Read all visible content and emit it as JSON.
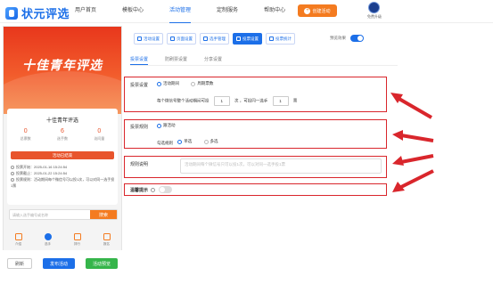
{
  "logo": {
    "text": "状元评选"
  },
  "nav": {
    "items": [
      {
        "label": "用户首页",
        "active": false
      },
      {
        "label": "模板中心",
        "active": false
      },
      {
        "label": "活动管理",
        "active": true
      },
      {
        "label": "定制服务",
        "active": false
      },
      {
        "label": "帮助中心",
        "active": false
      }
    ],
    "create_label": "创建活动",
    "user_label": "免费升级"
  },
  "preview": {
    "banner_title": "十佳青年评选",
    "card_title": "十佳青年评选",
    "stats": [
      {
        "value": "0",
        "label": "总票数"
      },
      {
        "value": "6",
        "label": "选手数"
      },
      {
        "value": "0",
        "label": "访问量"
      }
    ],
    "countdown": "活动已结束",
    "rules": [
      "投票开始：2025-01-16 15:24:54",
      "投票截止：2025-01-22 15:24:54",
      "投票规则：活动期间每个微信号可以投1次，可以对同一选手投1票"
    ],
    "search_placeholder": "请输入选手编号或名称",
    "search_button": "搜索",
    "tabs": [
      {
        "label": "介绍",
        "active": false
      },
      {
        "label": "选手",
        "active": true
      },
      {
        "label": "排行",
        "active": false
      },
      {
        "label": "报名",
        "active": false
      }
    ]
  },
  "bottom_buttons": {
    "back": "刷新",
    "publish": "发布活动",
    "save": "活动预览"
  },
  "toolbar": {
    "buttons": [
      {
        "label": "活动设置",
        "active": false
      },
      {
        "label": "页面设置",
        "active": false
      },
      {
        "label": "选手管理",
        "active": false
      },
      {
        "label": "投票设置",
        "active": true
      },
      {
        "label": "投票统计",
        "active": false
      }
    ],
    "preview_label": "预览效果",
    "preview_on": true
  },
  "subtabs": [
    {
      "label": "投票设置",
      "active": true
    },
    {
      "label": "防刷票设置",
      "active": false
    },
    {
      "label": "分享设置",
      "active": false
    }
  ],
  "vote_settings": {
    "type_label": "投票设置",
    "type_options": [
      "活动期间",
      "周期票数"
    ],
    "rule_prefix": "每个微信号整个活动期间可投",
    "count1": "1",
    "unit1": "次",
    "rule_mid": "，可投同一选手",
    "count2": "1",
    "unit2": "票"
  },
  "vote_rules": {
    "label": "投票规则",
    "option": "跟活动",
    "mode_label": "勾选规则",
    "mode_options": [
      "单选",
      "多选"
    ]
  },
  "rule_desc": {
    "label": "规则说明",
    "placeholder": "活动期间每个微信号只可以投1次，可以对同一选手投1票"
  },
  "reminder": {
    "label": "温馨提示",
    "on": false
  },
  "colors": {
    "accent": "#1c6fe8",
    "orange": "#f47b20",
    "highlight": "#d9262c"
  }
}
